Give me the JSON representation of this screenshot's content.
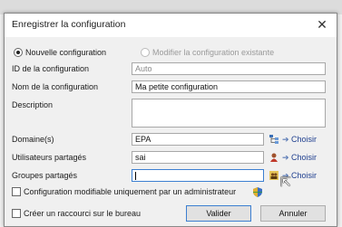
{
  "background": {
    "left_text": "",
    "right_text": ""
  },
  "dialog": {
    "title": "Enregistrer la configuration",
    "close_glyph": "✕"
  },
  "mode": {
    "new_label": "Nouvelle configuration",
    "modify_label": "Modifier la configuration existante",
    "selected": "new"
  },
  "fields": {
    "id_label": "ID de la configuration",
    "id_value": "Auto",
    "name_label": "Nom de la configuration",
    "name_value": "Ma petite configuration",
    "description_label": "Description",
    "description_value": "",
    "domains_label": "Domaine(s)",
    "domains_value": "EPA",
    "users_label": "Utilisateurs partagés",
    "users_value": "sai",
    "groups_label": "Groupes partagés",
    "groups_value": ""
  },
  "pickers": {
    "choose_label": "Choisir",
    "arrow_glyph": "➔",
    "domain_icon": "domain-tree-icon",
    "user_icon": "user-icon",
    "group_icon": "group-icon"
  },
  "options": {
    "admin_only_label": "Configuration modifiable uniquement par un administrateur",
    "admin_only_checked": false,
    "shortcut_label": "Créer un raccourci sur le bureau",
    "shortcut_checked": false
  },
  "buttons": {
    "ok": "Valider",
    "cancel": "Annuler"
  },
  "colors": {
    "link": "#1f3f8f",
    "focus_border": "#3c7fd1",
    "disabled_text": "#9a9a9a"
  }
}
